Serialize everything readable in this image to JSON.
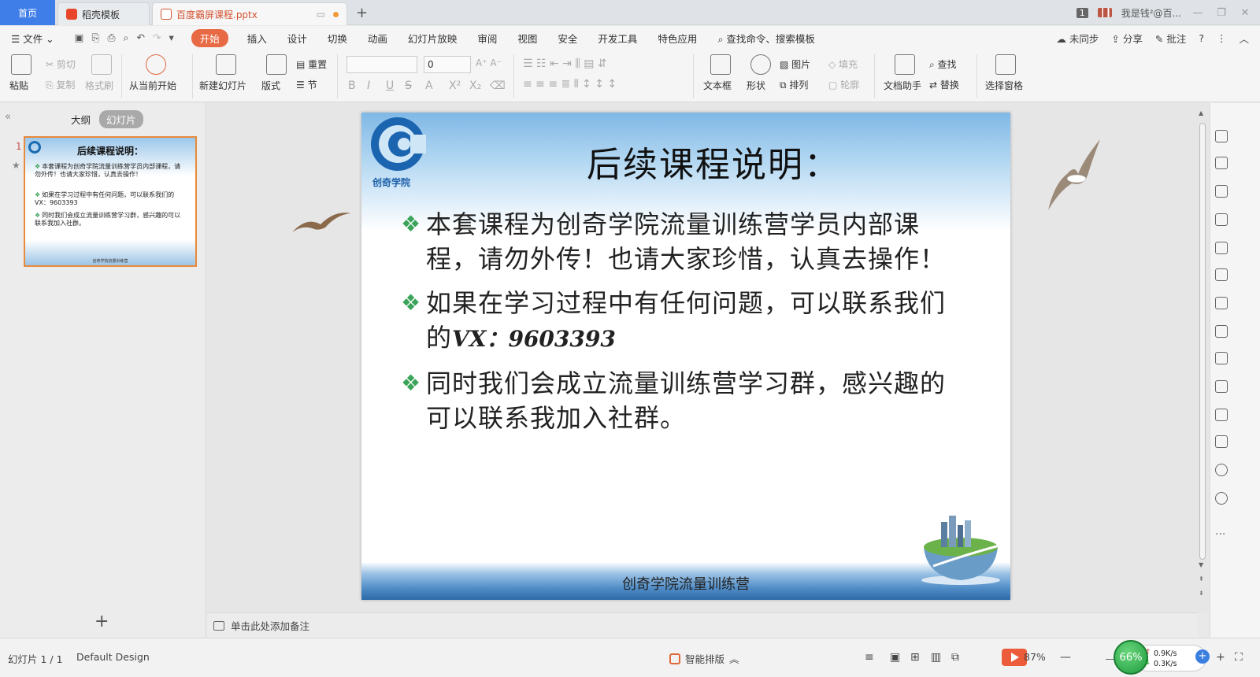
{
  "tabs": {
    "home": "首页",
    "template": "稻壳模板",
    "file": "百度霸屏课程.pptx"
  },
  "titlebar": {
    "window_count": "1",
    "user": "我是钱²@百..."
  },
  "menu": {
    "file": "文件",
    "items": [
      "开始",
      "插入",
      "设计",
      "切换",
      "动画",
      "幻灯片放映",
      "审阅",
      "视图",
      "安全",
      "开发工具",
      "特色应用"
    ],
    "search": "查找命令、搜索模板",
    "sync": "未同步",
    "share": "分享",
    "comment": "批注"
  },
  "ribbon": {
    "paste": "粘贴",
    "cut": "剪切",
    "copy": "复制",
    "format_painter": "格式刷",
    "play_from_current": "从当前开始",
    "new_slide": "新建幻灯片",
    "layout": "版式",
    "reset": "重置",
    "section": "节",
    "font_size": "0",
    "textbox": "文本框",
    "shape": "形状",
    "picture": "图片",
    "fill": "填充",
    "arrange": "排列",
    "outline": "轮廓",
    "doc_assistant": "文档助手",
    "find": "查找",
    "replace": "替换",
    "select_pane": "选择窗格"
  },
  "left_panel": {
    "outline_tab": "大纲",
    "slides_tab": "幻灯片",
    "slide_number": "1",
    "thumbnail": {
      "title": "后续课程说明：",
      "lines": [
        "本套课程为创奇学院流量训练营学员内部课程，请勿外传！也请大家珍惜，认真去操作！",
        "如果在学习过程中有任何问题，可以联系我们的VX：9603393",
        "同时我们会成立流量训练营学习群，感兴趣的可以联系我加入社群。"
      ],
      "footer": "创奇学院流量训练营"
    }
  },
  "slide": {
    "logo_text": "创奇学院",
    "title": "后续课程说明：",
    "bullets": [
      {
        "text": "本套课程为创奇学院流量训练营学员内部课程，请勿外传！也请大家珍惜，认真去操作！",
        "extra": ""
      },
      {
        "text": "如果在学习过程中有任何问题，可以联系我们的",
        "extra": "VX：9603393"
      },
      {
        "text": "同时我们会成立流量训练营学习群，感兴趣的可以联系我加入社群。",
        "extra": ""
      }
    ],
    "footer": "创奇学院流量训练营"
  },
  "notes": {
    "placeholder": "单击此处添加备注"
  },
  "status": {
    "slide_info": "幻灯片 1 / 1",
    "design": "Default Design",
    "smart_layout": "智能排版",
    "zoom": "87%",
    "net_percent": "66%",
    "upload": "0.9K/s",
    "download": "0.3K/s"
  },
  "colors": {
    "accent": "#e86a45",
    "home_tab": "#3f7ee8",
    "bullet_mark": "#3ba35a",
    "logo_blue": "#1a5fa8"
  }
}
